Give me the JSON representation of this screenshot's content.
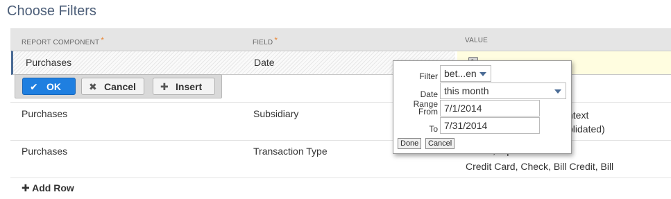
{
  "page": {
    "title": "Choose Filters"
  },
  "table": {
    "headers": {
      "component": "REPORT COMPONENT",
      "field": "FIELD",
      "value": "VALUE",
      "required_mark": "*"
    },
    "edit_row": {
      "component": "Purchases",
      "field": "Date"
    },
    "buttons": {
      "ok": "OK",
      "cancel": "Cancel",
      "insert": "Insert"
    },
    "rows": [
      {
        "component": "Purchases",
        "field": "Subsidiary",
        "value_line1": "ntext",
        "value_line2": "blidated)"
      },
      {
        "component": "Purchases",
        "field": "Transaction Type",
        "value_line1": "Filter , equal to",
        "value_line2": "Credit Card, Check, Bill Credit, Bill"
      }
    ],
    "add_row": "Add Row"
  },
  "popup": {
    "filter_label": "Filter",
    "filter_value": "bet...en",
    "date_range_label": "Date Range",
    "date_range_value": "this month",
    "from_label": "From",
    "from_value": "7/1/2014",
    "to_label": "To",
    "to_value": "7/31/2014",
    "done": "Done",
    "cancel": "Cancel"
  },
  "colors": {
    "accent": "#1f7fe0",
    "required": "#e8893a",
    "title": "#4d5f79",
    "edit_highlight": "#fffde0"
  }
}
